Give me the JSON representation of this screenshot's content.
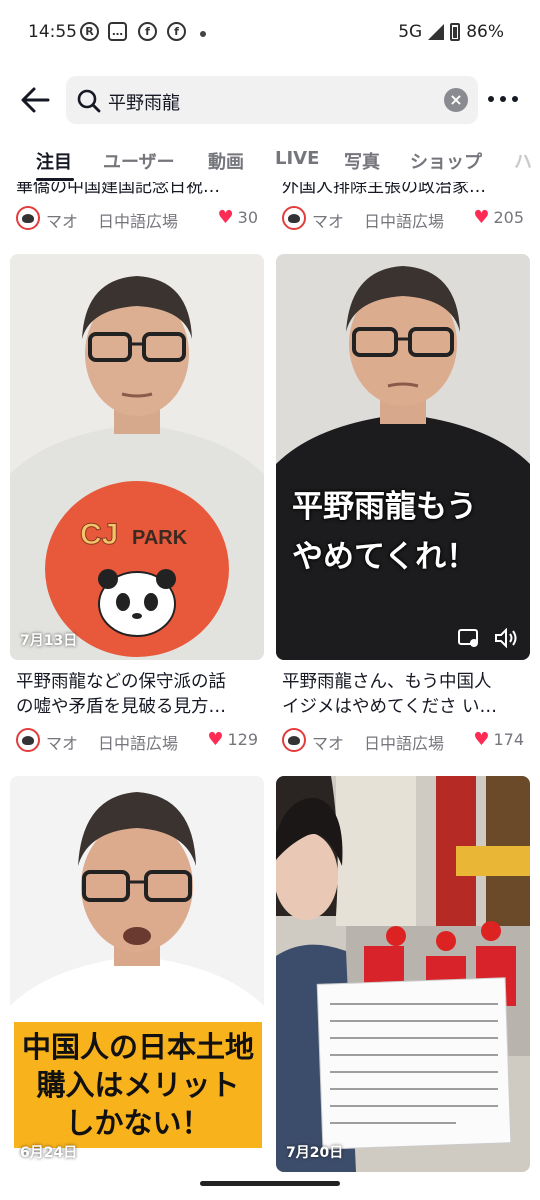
{
  "status_bar": {
    "time": "14:55",
    "network": "5G",
    "battery": "86%",
    "notification_icons": [
      "R",
      "chat",
      "f",
      "f"
    ]
  },
  "search": {
    "query": "平野雨龍",
    "clear_label": "×"
  },
  "tabs": [
    {
      "label": "注目",
      "active": true
    },
    {
      "label": "ユーザー",
      "active": false
    },
    {
      "label": "動画",
      "active": false
    },
    {
      "label": "LIVE",
      "active": false
    },
    {
      "label": "写真",
      "active": false
    },
    {
      "label": "ショップ",
      "active": false
    },
    {
      "label": "ハ",
      "active": false
    }
  ],
  "top_row": [
    {
      "title_partial": "華僑の中国建国記念日祝…",
      "author": "マオ",
      "place": "日中語広場",
      "likes": "30"
    },
    {
      "title_partial": "外国人排除主張の政治家…",
      "author": "マオ",
      "place": "日中語広場",
      "likes": "205"
    }
  ],
  "cards": [
    {
      "date": "7月13日",
      "title_line1": "平野雨龍などの保守派の話",
      "title_line2": "の嘘や矛盾を見破る見方…",
      "author": "マオ",
      "place": "日中語広場",
      "likes": "129",
      "shirt_text": "CJ PARK"
    },
    {
      "date": "",
      "overlay_line1": "平野雨龍もう",
      "overlay_line2": "やめてくれ！",
      "title_line1": "平野雨龍さん、もう中国人",
      "title_line2": "イジメはやめてくださ い…",
      "author": "マオ",
      "place": "日中語広場",
      "likes": "174"
    },
    {
      "date": "6月24日",
      "overlay_line1": "中国人の日本土地",
      "overlay_line2": "購入はメリット",
      "overlay_line3": "しかない！"
    },
    {
      "date": "7月20日",
      "sign_text": "我们在中华人民共和国成立75 周年之际表示强烈不满。我国反对 该国侵略东突厥斯坦，侵略西藏， 破坏香港人民自由，威胁台湾 独立。中国人民隐瞒新疆… 所不满，中国政府，将这一切消除 今后，中国人的生活将更加困难 中国人不认可此事 当独立。"
    }
  ],
  "colors": {
    "accent_like": "#fe2c55",
    "text_primary": "#161823",
    "text_secondary": "#75767c",
    "yellow_caption": "#f7b21c"
  }
}
